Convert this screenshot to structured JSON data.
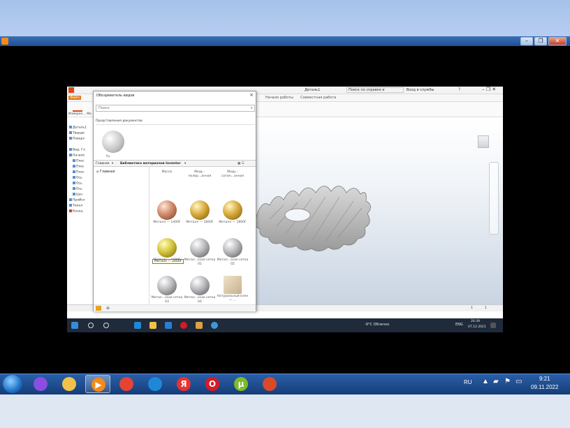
{
  "outer_window": {
    "controls": [
      "–",
      "❐",
      "✕"
    ]
  },
  "inventor": {
    "doc_title": "Деталь1",
    "help_search": "Поиск по справке и командам",
    "signin": "Вход в службы",
    "ribbon_tabs": [
      "Начало работы",
      "Совместная работа"
    ],
    "status_text": "элементы, детали",
    "status_right": [
      "1",
      "1"
    ],
    "browser_items": [
      "Деталь1",
      "Твердо",
      "Поверх",
      "Вид: Гл",
      "Начало",
      "Плос",
      "Плос",
      "Плос",
      "Ось",
      "Ось",
      "Ось",
      "Цен",
      "ПроИсх",
      "Топол",
      "Конец"
    ]
  },
  "material_dialog": {
    "title": "Обозреватель видов",
    "search_placeholder": "Поиск",
    "doc_section": "Представления документов",
    "doc_thumb_caption": "Ры",
    "lib_home": "Главная",
    "lib_name": "Библиотека материалов Inventor",
    "tree_home": "Главная",
    "tiles": [
      {
        "label": "Масло",
        "ball": "none"
      },
      {
        "label": "Медь - полир...анная",
        "ball": "none"
      },
      {
        "label": "Медь - сатин...анная",
        "ball": "none"
      },
      {
        "label": "Металл — 1400F",
        "ball": "copper"
      },
      {
        "label": "Металл — 1600F",
        "ball": "gold"
      },
      {
        "label": "Металл — 1800F",
        "ball": "gold"
      },
      {
        "label": "Металл — 2400F",
        "ball": "yellow"
      },
      {
        "label": "Метал...ская сетка 01",
        "ball": "silver"
      },
      {
        "label": "Метал...ская сетка 02",
        "ball": "silver"
      },
      {
        "label": "Метал...ская сетка 03",
        "ball": "silver"
      },
      {
        "label": "Метал...ская сетка 04",
        "ball": "silver"
      },
      {
        "label": "Натуральный клен — ...",
        "ball": "beige"
      }
    ],
    "tooltip": "Металл — 2400F"
  },
  "inner_taskbar": {
    "weather": "-9°C Облачно",
    "lang": "ENG",
    "time": "20:39",
    "date": "07.12.2021"
  },
  "taskbar": {
    "lang": "RU",
    "time": "9:21",
    "date": "09.11.2022",
    "apps": [
      {
        "name": "alice",
        "glyph": "",
        "color": "#8a4fe0"
      },
      {
        "name": "explorer",
        "glyph": "",
        "color": "#f2c14a"
      },
      {
        "name": "media-player",
        "glyph": "▶",
        "color": "#f28b1c"
      },
      {
        "name": "chrome",
        "glyph": "",
        "color": "#e54335"
      },
      {
        "name": "edge",
        "glyph": "",
        "color": "#1e88d8"
      },
      {
        "name": "yandex",
        "glyph": "Я",
        "color": "#e8322f"
      },
      {
        "name": "opera",
        "glyph": "O",
        "color": "#d81a25"
      },
      {
        "name": "utorrent",
        "glyph": "µ",
        "color": "#7dbb2c"
      },
      {
        "name": "presentation",
        "glyph": "",
        "color": "#d84a2a"
      }
    ]
  },
  "colors": {
    "accent": "#2a5fa8",
    "dialog_border": "#9a9a9a"
  }
}
